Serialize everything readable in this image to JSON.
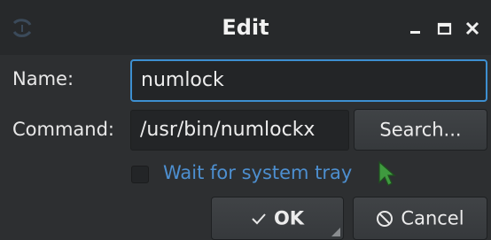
{
  "window": {
    "title": "Edit",
    "icons": {
      "app": "app-logo-icon",
      "minimize": "minimize-icon",
      "maximize": "maximize-icon",
      "close": "close-icon"
    }
  },
  "form": {
    "name_label": "Name:",
    "name_value": "numlock",
    "command_label": "Command:",
    "command_value": "/usr/bin/numlockx",
    "search_label": "Search...",
    "wait_label": "Wait for system tray",
    "wait_checked": false
  },
  "buttons": {
    "ok_label": "OK",
    "ok_icon": "checkmark-icon",
    "cancel_label": "Cancel",
    "cancel_icon": "cancel-circle-icon"
  },
  "colors": {
    "accent": "#3d8fd1",
    "link_text": "#4d8fd0",
    "background": "#2d2f31",
    "titlebar": "#27292b"
  }
}
